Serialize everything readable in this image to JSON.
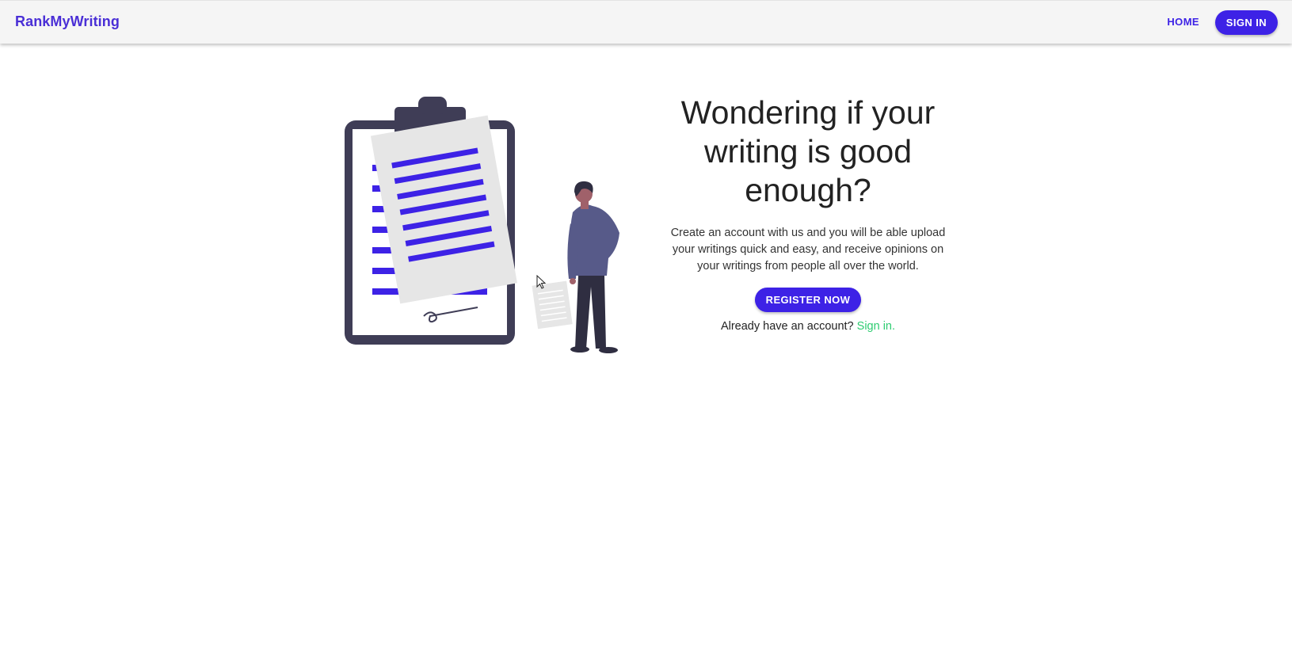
{
  "navbar": {
    "brand": "RankMyWriting",
    "home_label": "HOME",
    "signin_label": "SIGN IN"
  },
  "hero": {
    "title": "Wondering if your writing is good enough?",
    "description": "Create an account with us and you will be able upload your writings quick and easy, and receive opinions on your writings from people all over the world.",
    "register_label": "REGISTER NOW",
    "account_prompt": "Already have an account?",
    "signin_link": "Sign in."
  },
  "illustration": {
    "icon": "clipboard-person-illustration"
  },
  "colors": {
    "brand": "#4a2fd6",
    "accent": "#3d22e6",
    "link": "#2ecc71",
    "navbar_bg": "#f5f5f5",
    "clipboard": "#3f3d56"
  }
}
